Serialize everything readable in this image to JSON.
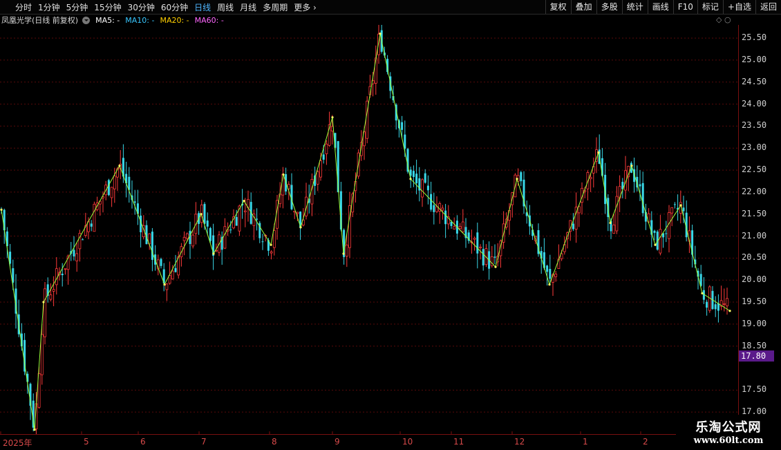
{
  "toolbar": {
    "periods": [
      "分时",
      "1分钟",
      "5分钟",
      "15分钟",
      "30分钟",
      "60分钟",
      "日线",
      "周线",
      "月线",
      "多周期",
      "更多"
    ],
    "active_period": "日线",
    "buttons": [
      "复权",
      "叠加",
      "多股",
      "统计",
      "画线",
      "F10",
      "标记",
      "+自选",
      "返回"
    ]
  },
  "title": {
    "stock_name": "凤凰光学(日线 前复权)",
    "ma5": "MA5: -",
    "ma10": "MA10: -",
    "ma20": "MA20: -",
    "ma60": "MA60: -"
  },
  "price_axis": {
    "ticks": [
      "25.50",
      "25.00",
      "24.50",
      "24.00",
      "23.50",
      "23.00",
      "22.50",
      "22.00",
      "21.50",
      "21.00",
      "20.50",
      "20.00",
      "19.50",
      "19.00",
      "18.50",
      "17.50",
      "17.00"
    ],
    "current_price": "17.80"
  },
  "date_axis": {
    "labels": [
      "2025年",
      "5",
      "6",
      "7",
      "8",
      "9",
      "10",
      "11",
      "12",
      "1",
      "2"
    ]
  },
  "colors": {
    "up": "#ff3a3a",
    "down": "#39d8e8",
    "zigzag": "#9cff3a",
    "grid": "#5a0a0a"
  },
  "watermark": {
    "title": "乐淘公式网",
    "url": "www.60lt.com"
  },
  "chart_data": {
    "type": "candlestick",
    "ylim": [
      16.5,
      25.8
    ],
    "zigzag": [
      21.6,
      16.6,
      19.5,
      22.6,
      19.9,
      21.5,
      20.6,
      21.8,
      20.8,
      22.4,
      21.2,
      23.7,
      20.6,
      25.6,
      22.3,
      20.3,
      22.3,
      19.9,
      22.9,
      21.3,
      22.6,
      20.8,
      21.7,
      19.7,
      19.3
    ]
  }
}
